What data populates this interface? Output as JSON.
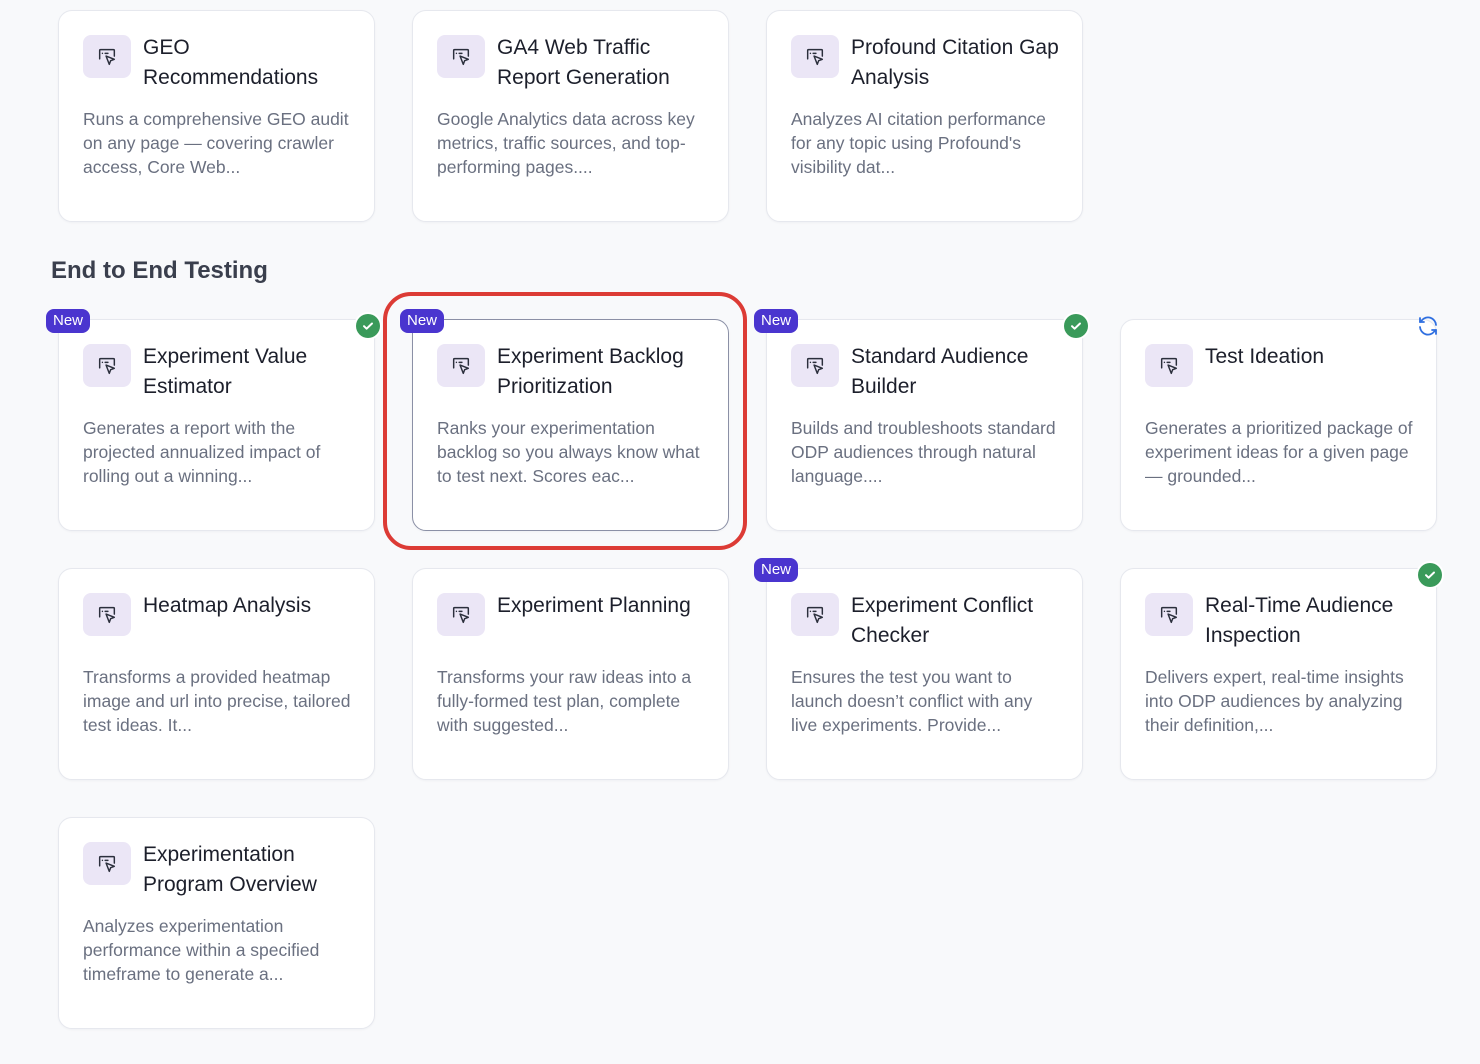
{
  "top_cards": [
    {
      "title": "GEO Recommendations",
      "description": "Runs a comprehensive GEO audit on any page — covering crawler access, Core Web..."
    },
    {
      "title": "GA4 Web Traffic Report Generation",
      "description": "Google Analytics data across key metrics, traffic sources, and top-performing pages...."
    },
    {
      "title": "Profound Citation Gap Analysis",
      "description": "Analyzes AI citation performance for any topic using Profound's visibility dat..."
    }
  ],
  "section": {
    "title": "End to End Testing"
  },
  "badge_new_label": "New",
  "cards": [
    {
      "title": "Experiment Value Estimator",
      "description": "Generates a report with the projected annualized impact of rolling out a winning..."
    },
    {
      "title": "Experiment Backlog Prioritization",
      "description": "Ranks your experimentation backlog so you always know what to test next. Scores eac..."
    },
    {
      "title": "Standard Audience Builder",
      "description": "Builds and troubleshoots standard ODP audiences through natural language...."
    },
    {
      "title": "Test Ideation",
      "description": "Generates a prioritized package of experiment ideas for a given page — grounded..."
    },
    {
      "title": "Heatmap Analysis",
      "description": "Transforms a provided heatmap image and url into precise, tailored test ideas. It..."
    },
    {
      "title": "Experiment Planning",
      "description": "Transforms your raw ideas into a fully-formed test plan, complete with suggested..."
    },
    {
      "title": "Experiment Conflict Checker",
      "description": "Ensures the test you want to launch doesn’t conflict with any live experiments. Provide..."
    },
    {
      "title": "Real-Time Audience Inspection",
      "description": "Delivers expert, real-time insights into ODP audiences by analyzing their definition,..."
    },
    {
      "title": "Experimentation Program Overview",
      "description": "Analyzes experimentation performance within a specified timeframe to generate a..."
    }
  ],
  "colors": {
    "accent_badge": "#4a35cf",
    "check_green": "#3a9a5a",
    "highlight_red": "#dc3b35",
    "icon_bg": "#ebe6f6",
    "sync_blue": "#2f6fe0"
  },
  "icons": {
    "card_icon": "cursor-click-icon",
    "status_check": "check-circle-icon",
    "status_sync": "sync-icon"
  }
}
